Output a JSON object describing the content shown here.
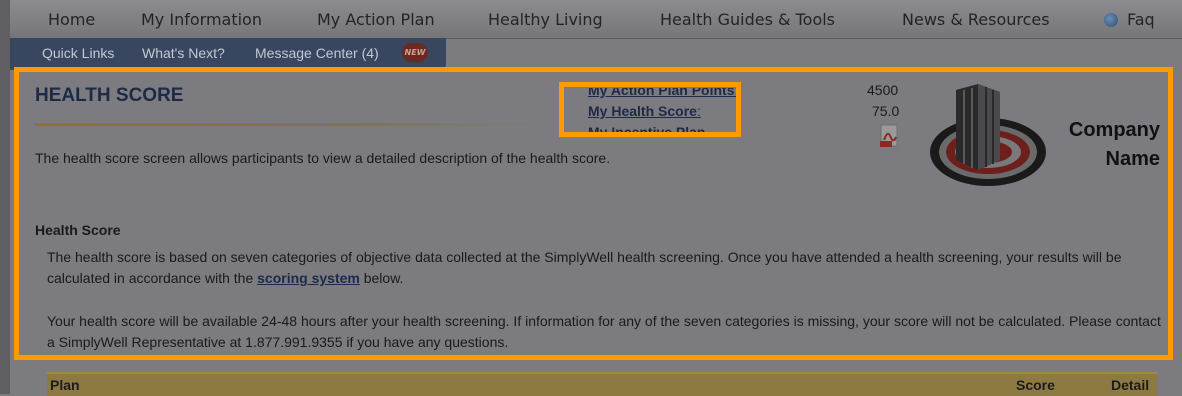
{
  "top_nav": {
    "items": [
      "Home",
      "My Information",
      "My Action Plan",
      "Healthy Living",
      "Health Guides & Tools",
      "News & Resources",
      "Faq"
    ]
  },
  "sub_nav": {
    "items": [
      "Quick Links",
      "What's Next?",
      "Message Center (4)"
    ],
    "badge": "NEW"
  },
  "page": {
    "title": "HEALTH SCORE",
    "description": "The health score screen allows participants to view a detailed description of the health score."
  },
  "summary": {
    "action_plan_label": "My Action Plan Points",
    "action_plan_value": "4500",
    "health_score_label": "My Health Score",
    "health_score_value": "75.0",
    "incentive_label": "My Incentive Plan",
    "colon": ":"
  },
  "logo": {
    "line1": "Company",
    "line2": "Name"
  },
  "health_score_section": {
    "heading": "Health Score",
    "para1_before": "The health score is based on seven categories of objective data collected at the SimplyWell health screening. Once you have attended a health screening, your results will be calculated in accordance with the ",
    "para1_link": "scoring system",
    "para1_after": " below.",
    "para2": "Your health score will be available 24-48 hours after your health screening. If information for any of the seven categories is missing, your score will not be calculated. Please contact a SimplyWell Representative at 1.877.991.9355 if you have any questions."
  },
  "table": {
    "columns": [
      "Plan",
      "Score",
      "Detail"
    ]
  },
  "colors": {
    "highlight": "#ff9a00",
    "link": "#1c2a48",
    "subnav_bg": "#394660"
  }
}
